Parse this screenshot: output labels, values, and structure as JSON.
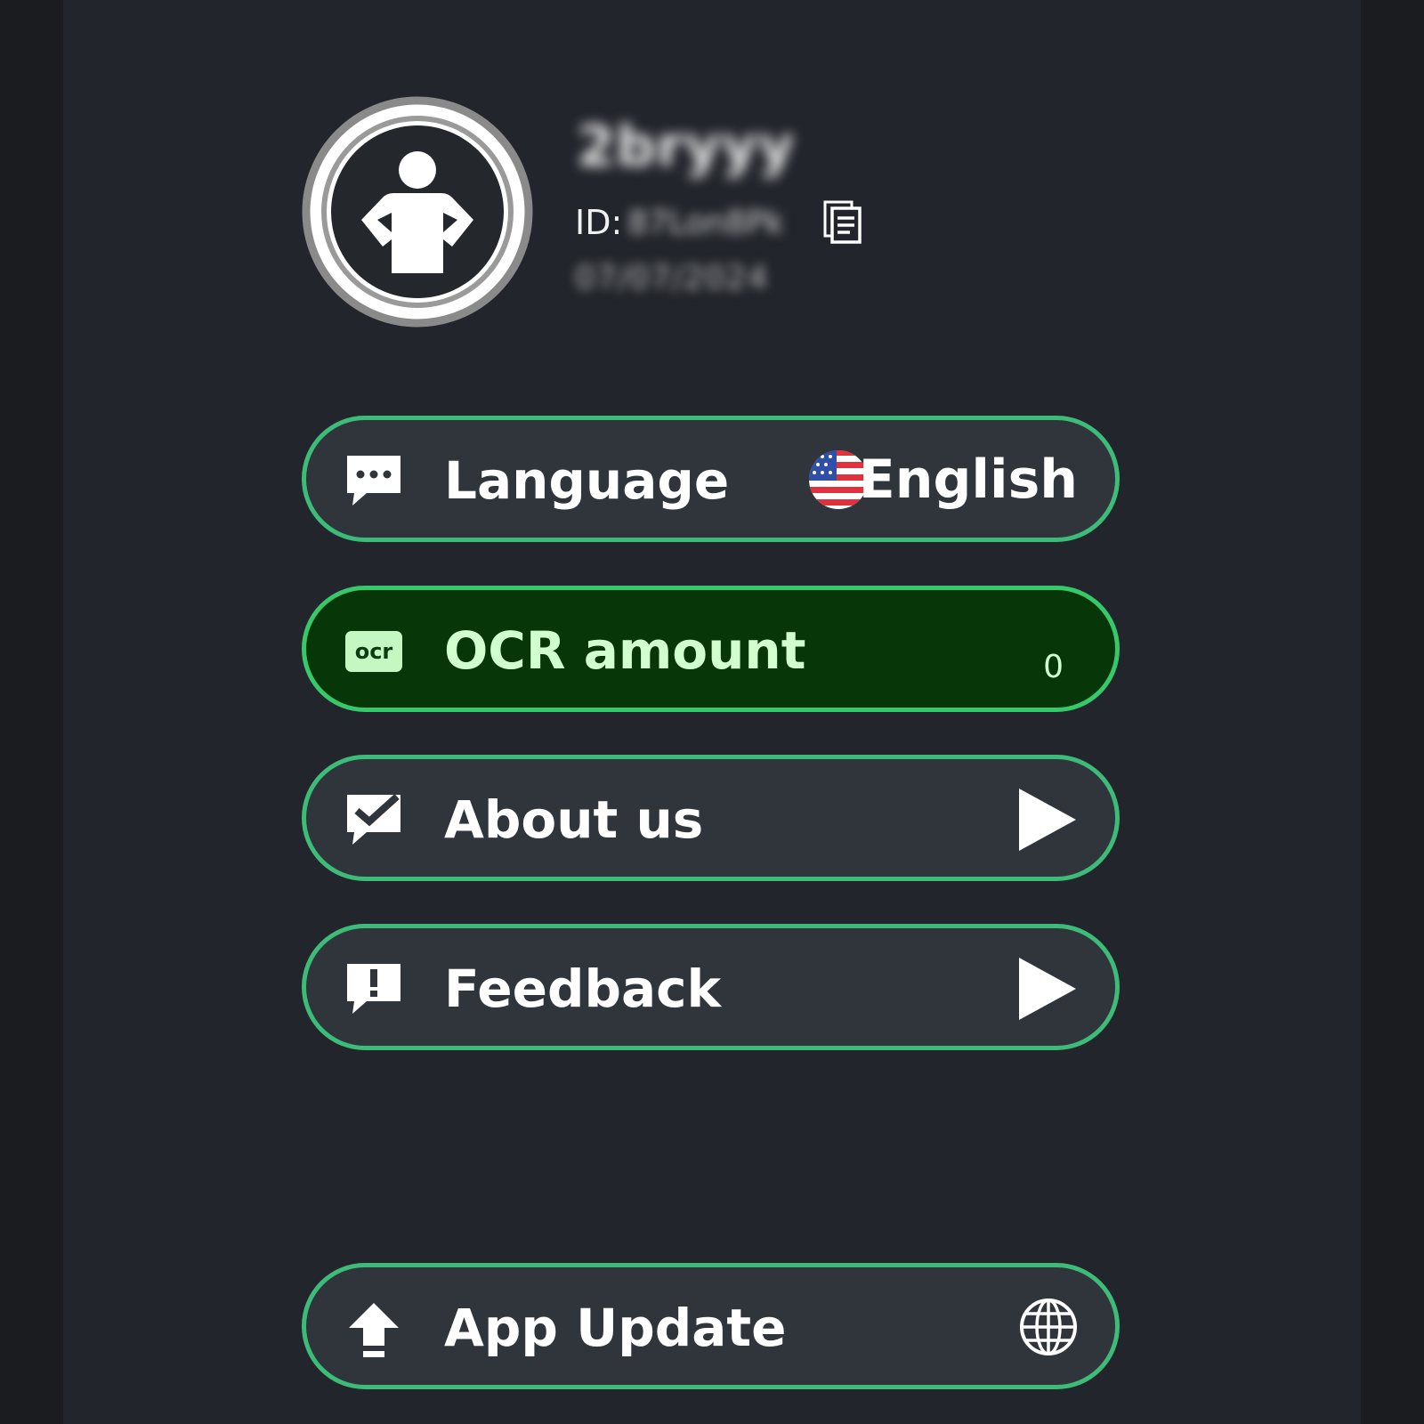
{
  "profile": {
    "username": "2bryyy",
    "id_label": "ID:",
    "id_value": "87Lon8Pk",
    "date": "07/07/2024"
  },
  "menu": {
    "language": {
      "label": "Language",
      "value": "English",
      "icon": "chat-bubble-icon",
      "flag": "us-flag-icon"
    },
    "ocr": {
      "label": "OCR amount",
      "count": "0",
      "icon": "ocr-icon"
    },
    "about": {
      "label": "About us",
      "icon": "checkmark-bubble-icon"
    },
    "feedback": {
      "label": "Feedback",
      "icon": "exclamation-bubble-icon"
    },
    "update": {
      "label": "App Update",
      "icon": "upload-arrow-icon",
      "right_icon": "globe-icon"
    }
  },
  "colors": {
    "background": "#22252b",
    "pill_background": "#30353b",
    "pill_border": "#3dbb78",
    "active_background": "#073609",
    "active_text": "#d2ffd0"
  }
}
